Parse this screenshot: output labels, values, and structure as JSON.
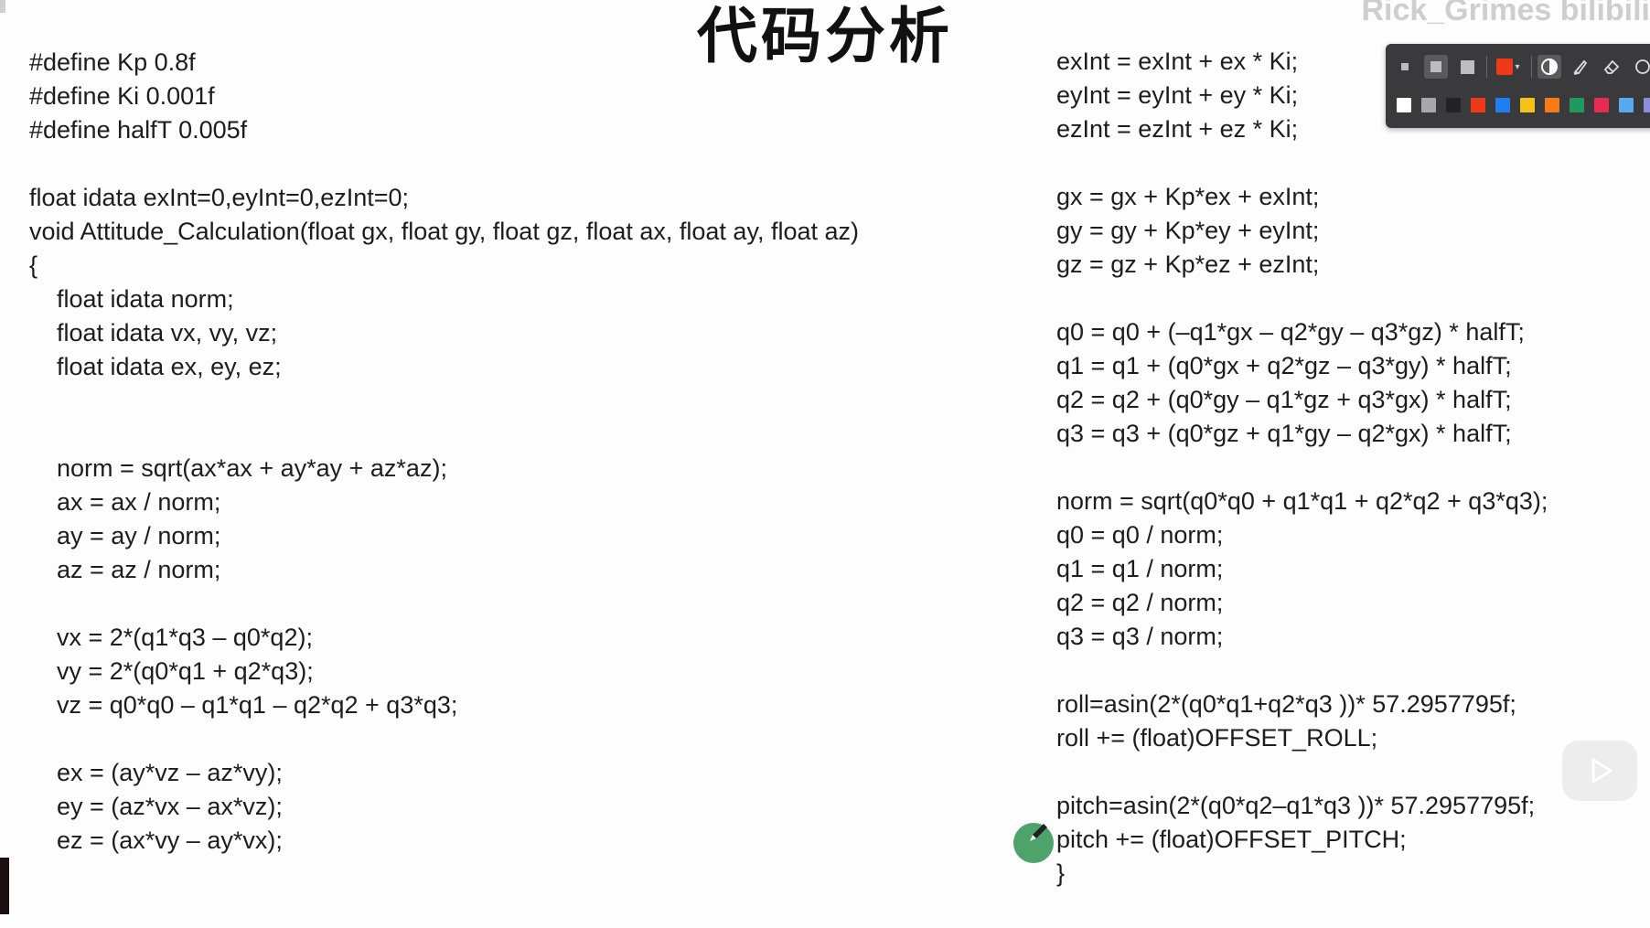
{
  "slide": {
    "title": "代码分析",
    "watermark": "Rick_Grimes bilibili"
  },
  "code_left": [
    "#define Kp 0.8f",
    "#define Ki 0.001f",
    "#define halfT 0.005f",
    "",
    "float idata exInt=0,eyInt=0,ezInt=0;",
    "void Attitude_Calculation(float gx, float gy, float gz, float ax, float ay, float az)",
    "{",
    "    float idata norm;",
    "    float idata vx, vy, vz;",
    "    float idata ex, ey, ez;",
    "",
    "",
    "    norm = sqrt(ax*ax + ay*ay + az*az);",
    "    ax = ax / norm;",
    "    ay = ay / norm;",
    "    az = az / norm;",
    "",
    "    vx = 2*(q1*q3 – q0*q2);",
    "    vy = 2*(q0*q1 + q2*q3);",
    "    vz = q0*q0 – q1*q1 – q2*q2 + q3*q3;",
    "",
    "    ex = (ay*vz – az*vy);",
    "    ey = (az*vx – ax*vz);",
    "    ez = (ax*vy – ay*vx);"
  ],
  "code_right": [
    "exInt = exInt + ex * Ki;",
    "eyInt = eyInt + ey * Ki;",
    "ezInt = ezInt + ez * Ki;",
    "",
    "gx = gx + Kp*ex + exInt;",
    "gy = gy + Kp*ey + eyInt;",
    "gz = gz + Kp*ez + ezInt;",
    "",
    "q0 = q0 + (–q1*gx – q2*gy – q3*gz) * halfT;",
    "q1 = q1 + (q0*gx + q2*gz – q3*gy) * halfT;",
    "q2 = q2 + (q0*gy – q1*gz + q3*gx) * halfT;",
    "q3 = q3 + (q0*gz + q1*gy – q2*gx) * halfT;",
    "",
    "norm = sqrt(q0*q0 + q1*q1 + q2*q2 + q3*q3);",
    "q0 = q0 / norm;",
    "q1 = q1 / norm;",
    "q2 = q2 / norm;",
    "q3 = q3 / norm;",
    "",
    "roll=asin(2*(q0*q1+q2*q3 ))* 57.2957795f;",
    "roll += (float)OFFSET_ROLL;",
    "",
    "pitch=asin(2*(q0*q2–q1*q3 ))* 57.2957795f;",
    "pitch += (float)OFFSET_PITCH;",
    "}"
  ],
  "toolbar": {
    "tools": [
      {
        "icon": "small-square-icon"
      },
      {
        "icon": "medium-square-icon",
        "active": true
      },
      {
        "icon": "large-square-icon"
      },
      {
        "icon": "color-picker-icon",
        "color": "#f03a17"
      },
      {
        "icon": "contrast-icon",
        "active": true
      },
      {
        "icon": "highlighter-icon"
      },
      {
        "icon": "eraser-icon"
      },
      {
        "icon": "more-icon"
      }
    ],
    "swatches": [
      "#ffffff",
      "#a8a8a8",
      "#222222",
      "#f03a17",
      "#1e7ff0",
      "#f6c218",
      "#f57b16",
      "#1f9a5c",
      "#e82a4e",
      "#5aa8f0",
      "#8a8fd8",
      "#f0c018"
    ]
  },
  "overlay": {
    "pen_cursor_color": "#4ea36a",
    "play_icon": "play-icon"
  }
}
